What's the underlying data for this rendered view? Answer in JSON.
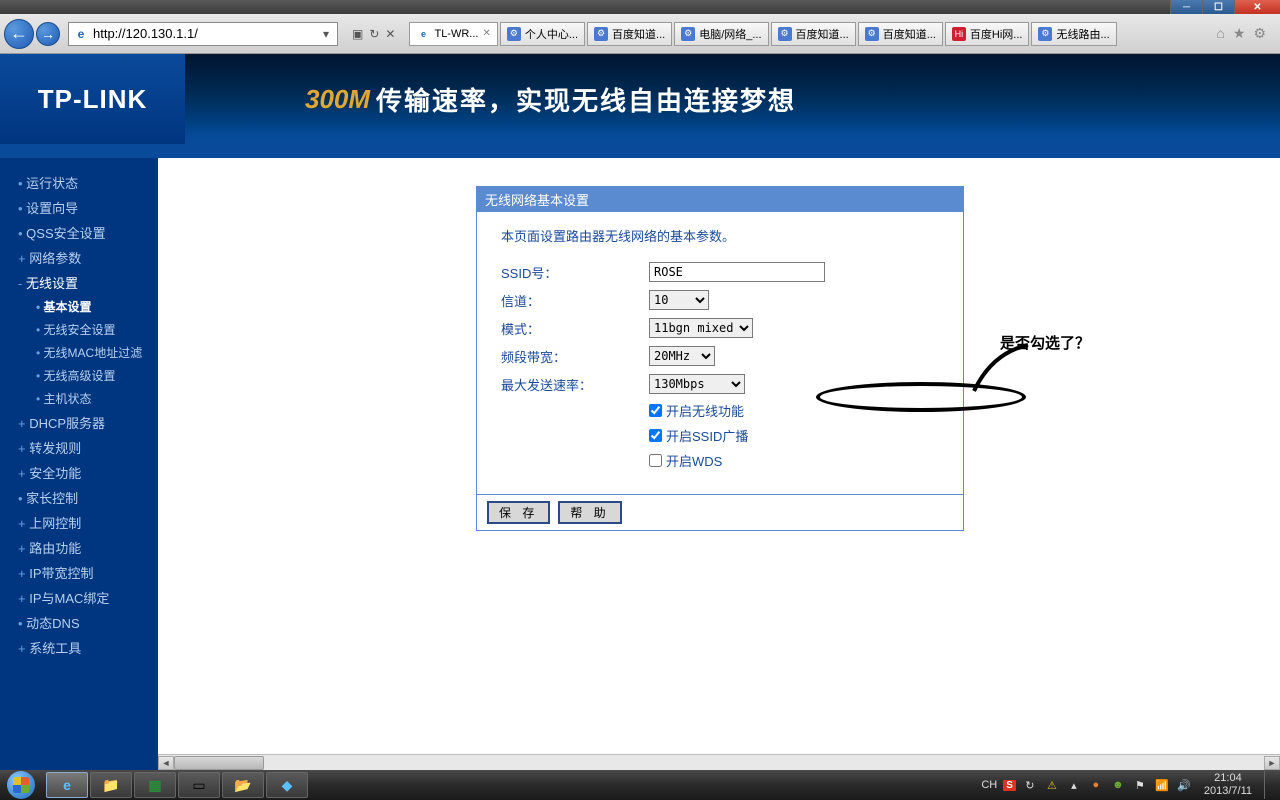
{
  "window": {
    "min": "─",
    "max": "☐",
    "close": "✕"
  },
  "browser": {
    "url": "http://120.130.1.1/",
    "tabs": [
      {
        "label": "TL-WR...",
        "icon": "ie",
        "active": true
      },
      {
        "label": "个人中心...",
        "icon": "baike"
      },
      {
        "label": "百度知道...",
        "icon": "baike"
      },
      {
        "label": "电脑/网络_...",
        "icon": "baike"
      },
      {
        "label": "百度知道...",
        "icon": "baike"
      },
      {
        "label": "百度知道...",
        "icon": "baike"
      },
      {
        "label": "百度Hi网...",
        "icon": "hi"
      },
      {
        "label": "无线路由...",
        "icon": "baike"
      }
    ]
  },
  "header": {
    "logo": "TP-LINK",
    "banner_highlight": "300M",
    "banner_text": "传输速率，实现无线自由连接梦想"
  },
  "sidebar": {
    "items": [
      {
        "label": "运行状态",
        "type": "leaf"
      },
      {
        "label": "设置向导",
        "type": "leaf"
      },
      {
        "label": "QSS安全设置",
        "type": "leaf"
      },
      {
        "label": "网络参数",
        "type": "collapsed"
      },
      {
        "label": "无线设置",
        "type": "expanded",
        "children": [
          {
            "label": "基本设置",
            "current": true
          },
          {
            "label": "无线安全设置"
          },
          {
            "label": "无线MAC地址过滤"
          },
          {
            "label": "无线高级设置"
          },
          {
            "label": "主机状态"
          }
        ]
      },
      {
        "label": "DHCP服务器",
        "type": "collapsed"
      },
      {
        "label": "转发规则",
        "type": "collapsed"
      },
      {
        "label": "安全功能",
        "type": "collapsed"
      },
      {
        "label": "家长控制",
        "type": "leaf"
      },
      {
        "label": "上网控制",
        "type": "collapsed"
      },
      {
        "label": "路由功能",
        "type": "collapsed"
      },
      {
        "label": "IP带宽控制",
        "type": "collapsed"
      },
      {
        "label": "IP与MAC绑定",
        "type": "collapsed"
      },
      {
        "label": "动态DNS",
        "type": "leaf"
      },
      {
        "label": "系统工具",
        "type": "collapsed"
      }
    ]
  },
  "panel": {
    "title": "无线网络基本设置",
    "description": "本页面设置路由器无线网络的基本参数。",
    "ssid_label": "SSID号：",
    "ssid_value": "ROSE",
    "channel_label": "信道：",
    "channel_value": "10",
    "mode_label": "模式：",
    "mode_value": "11bgn mixed",
    "bandwidth_label": "频段带宽：",
    "bandwidth_value": "20MHz",
    "maxrate_label": "最大发送速率：",
    "maxrate_value": "130Mbps",
    "check_wireless": "开启无线功能",
    "check_wireless_checked": true,
    "check_ssid": "开启SSID广播",
    "check_ssid_checked": true,
    "check_wds": "开启WDS",
    "check_wds_checked": false,
    "btn_save": "保 存",
    "btn_help": "帮 助"
  },
  "annotation": {
    "text": "是否勾选了？"
  },
  "taskbar": {
    "ime": "CH",
    "tray_time": "21:04",
    "tray_date": "2013/7/11"
  }
}
